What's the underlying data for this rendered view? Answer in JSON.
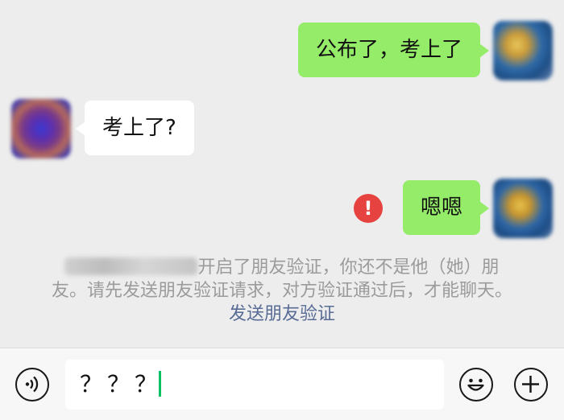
{
  "messages": [
    {
      "sender": "me",
      "text": "公布了，考上了"
    },
    {
      "sender": "other",
      "text": "考上了?"
    },
    {
      "sender": "me",
      "text": "嗯嗯",
      "status": "failed"
    }
  ],
  "system_notice": {
    "text": "开启了朋友验证，你还不是他（她）朋友。请先发送朋友验证请求，对方验证通过后，才能聊天。",
    "link": "发送朋友验证"
  },
  "input_bar": {
    "value": "？？？",
    "icons": [
      "voice-icon",
      "emoji-icon",
      "plus-icon"
    ]
  },
  "colors": {
    "background": "#ededed",
    "my_bubble": "#95ec69",
    "other_bubble": "#ffffff",
    "error": "#e64340",
    "link": "#576b95",
    "caret": "#07c160"
  }
}
